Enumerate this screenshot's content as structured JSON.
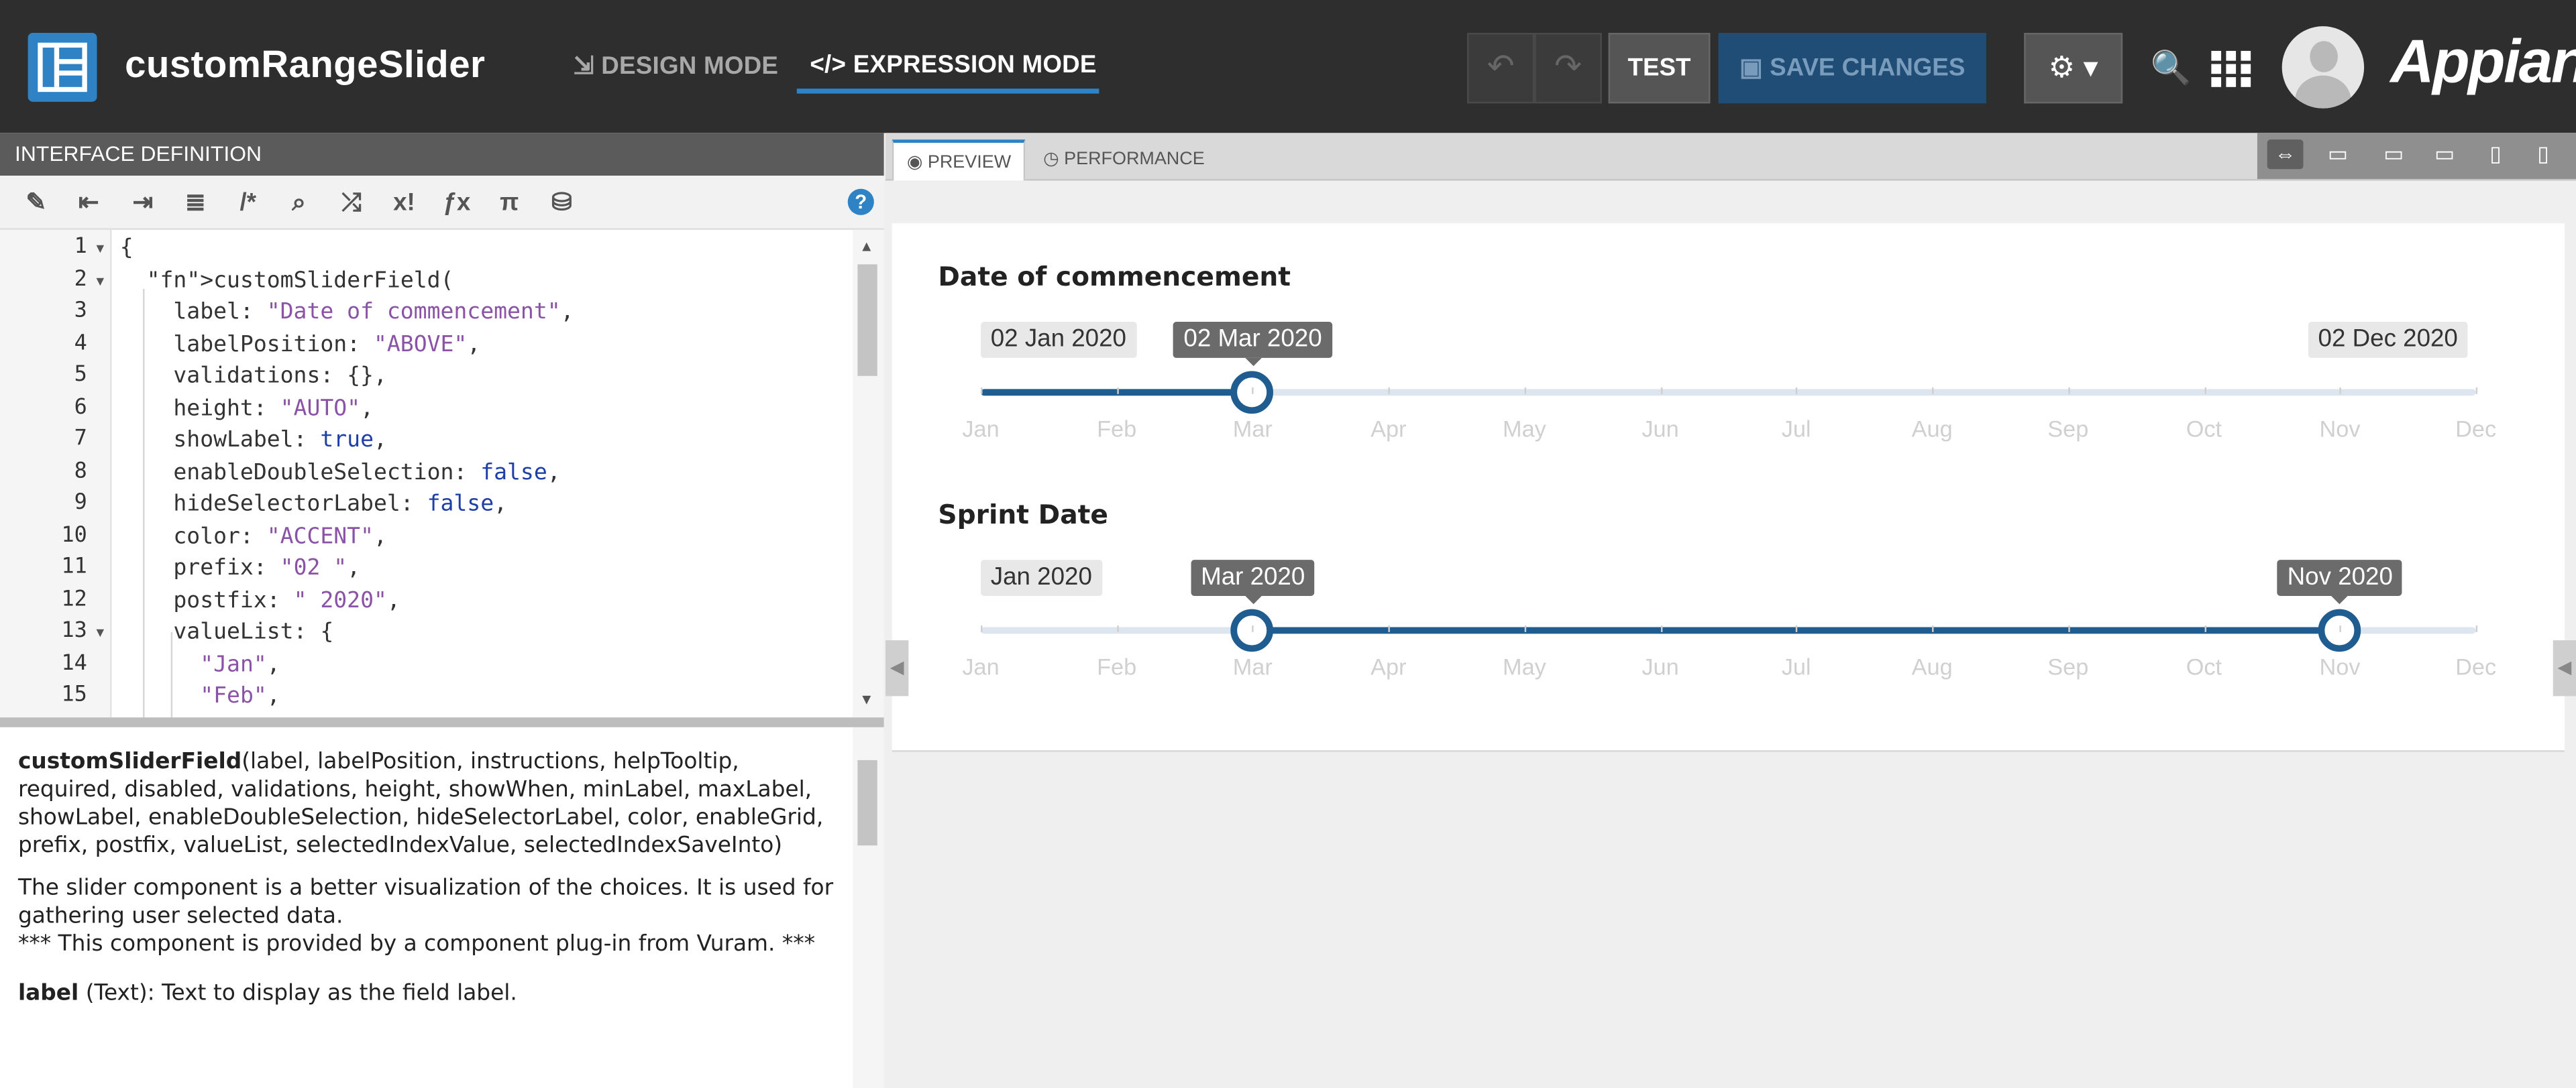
{
  "app": {
    "title": "customRangeSlider",
    "brand": "Appian"
  },
  "modes": {
    "design": "DESIGN MODE",
    "expression": "EXPRESSION MODE"
  },
  "toolbar": {
    "test_label": "TEST",
    "save_label": "SAVE CHANGES"
  },
  "left_panel": {
    "header": "INTERFACE DEFINITION",
    "code_lines": [
      {
        "n": "1",
        "fold": true,
        "text": "{"
      },
      {
        "n": "2",
        "fold": true,
        "text": "  customSliderField("
      },
      {
        "n": "3",
        "fold": false,
        "text": "    label: \"Date of commencement\","
      },
      {
        "n": "4",
        "fold": false,
        "text": "    labelPosition: \"ABOVE\","
      },
      {
        "n": "5",
        "fold": false,
        "text": "    validations: {},"
      },
      {
        "n": "6",
        "fold": false,
        "text": "    height: \"AUTO\","
      },
      {
        "n": "7",
        "fold": false,
        "text": "    showLabel: true,"
      },
      {
        "n": "8",
        "fold": false,
        "text": "    enableDoubleSelection: false,"
      },
      {
        "n": "9",
        "fold": false,
        "text": "    hideSelectorLabel: false,"
      },
      {
        "n": "10",
        "fold": false,
        "text": "    color: \"ACCENT\","
      },
      {
        "n": "11",
        "fold": false,
        "text": "    prefix: \"02 \","
      },
      {
        "n": "12",
        "fold": false,
        "text": "    postfix: \" 2020\","
      },
      {
        "n": "13",
        "fold": true,
        "text": "    valueList: {"
      },
      {
        "n": "14",
        "fold": false,
        "text": "      \"Jan\","
      },
      {
        "n": "15",
        "fold": false,
        "text": "      \"Feb\","
      }
    ],
    "docs": {
      "signature_name": "customSliderField",
      "signature_params": "(label, labelPosition, instructions, helpTooltip, required, disabled, validations, height, showWhen, minLabel, maxLabel, showLabel, enableDoubleSelection, hideSelectorLabel, color, enableGrid, prefix, postfix, valueList, selectedIndexValue, selectedIndexSaveInto)",
      "description": "The slider component is a better visualization of the choices. It is used for gathering user selected data.",
      "note": "*** This component is provided by a component plug-in from Vuram. ***",
      "param_name": "label",
      "param_desc": " (Text): Text to display as the field label."
    }
  },
  "right_panel": {
    "tabs": {
      "preview": "PREVIEW",
      "performance": "PERFORMANCE"
    },
    "months": [
      "Jan",
      "Feb",
      "Mar",
      "Apr",
      "May",
      "Jun",
      "Jul",
      "Aug",
      "Sep",
      "Oct",
      "Nov",
      "Dec"
    ],
    "slider1": {
      "label": "Date of commencement",
      "min_label": "02 Jan 2020",
      "max_label": "02 Dec 2020",
      "selected_label": "02 Mar 2020",
      "selected_index": 2
    },
    "slider2": {
      "label": "Sprint Date",
      "min_label": "Jan 2020",
      "selected_start_label": "Mar 2020",
      "selected_end_label": "Nov 2020",
      "selected_start_index": 2,
      "selected_end_index": 10
    }
  },
  "colors": {
    "accent": "#1f5c8f",
    "topbar": "#2e2e2e",
    "brand_blue": "#2f83c5"
  },
  "icons": [
    "undo-icon",
    "redo-icon",
    "gear-icon",
    "globe-search-icon",
    "apps-grid-icon",
    "eye-icon",
    "clock-icon"
  ]
}
